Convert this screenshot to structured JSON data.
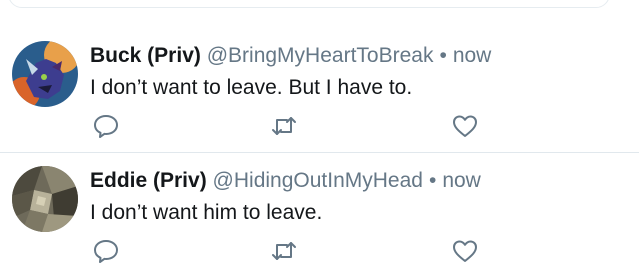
{
  "tweets": [
    {
      "name": "Buck (Priv)",
      "handle": "@BringMyHeartToBreak",
      "separator": "•",
      "time": "now",
      "text": "I don’t want to leave. But I have to.",
      "avatar_icon": "rhino-art-avatar"
    },
    {
      "name": "Eddie (Priv)",
      "handle": "@HidingOutInMyHead",
      "separator": "•",
      "time": "now",
      "text": "I don’t want him to leave.",
      "avatar_icon": "cubist-art-avatar"
    }
  ],
  "action_icons": [
    "reply-icon",
    "retweet-icon",
    "like-icon"
  ],
  "colors": {
    "text": "#14171a",
    "secondary": "#657786",
    "divider": "#e1e8ed"
  }
}
